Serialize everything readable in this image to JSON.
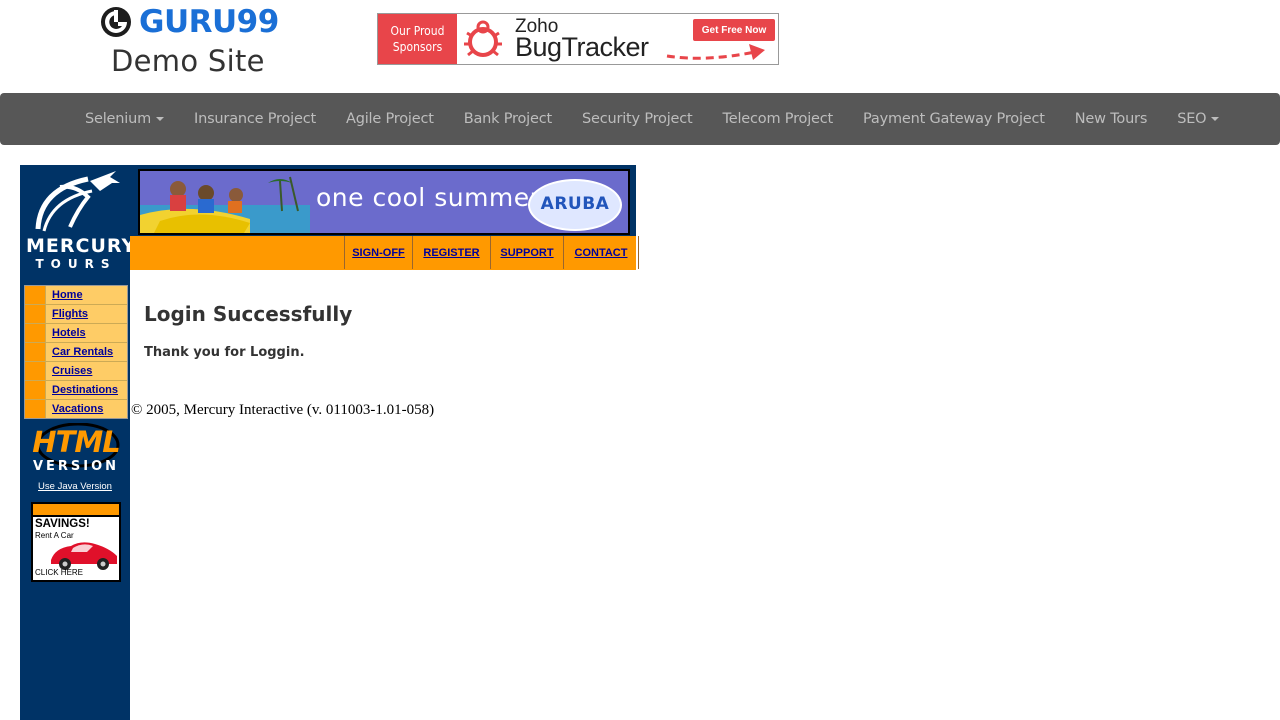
{
  "header": {
    "brand": "GURU99",
    "subtitle": "Demo Site",
    "sponsor": {
      "left_line1": "Our Proud",
      "left_line2": "Sponsors",
      "zoho": "Zoho",
      "product": "BugTracker",
      "cta": "Get Free Now"
    }
  },
  "navbar": {
    "items": [
      {
        "label": "Selenium",
        "dropdown": true
      },
      {
        "label": "Insurance Project"
      },
      {
        "label": "Agile Project"
      },
      {
        "label": "Bank Project"
      },
      {
        "label": "Security Project"
      },
      {
        "label": "Telecom Project"
      },
      {
        "label": "Payment Gateway Project"
      },
      {
        "label": "New Tours"
      },
      {
        "label": "SEO",
        "dropdown": true
      }
    ]
  },
  "mercury": {
    "logo_word1": "MERCURY",
    "logo_word2": "TOURS",
    "banner_text": "one cool summer",
    "banner_badge": "ARUBA",
    "top_links": [
      "SIGN-OFF",
      "REGISTER",
      "SUPPORT",
      "CONTACT"
    ],
    "menu": [
      "Home",
      "Flights",
      "Hotels",
      "Car Rentals",
      "Cruises",
      "Destinations",
      "Vacations"
    ],
    "html_version_line1": "HTML",
    "html_version_line2": "VERSION",
    "java_link": "Use Java Version",
    "savings_title": "SAVINGS!",
    "savings_sub": "Rent A Car",
    "savings_click": "CLICK HERE"
  },
  "content": {
    "title": "Login Successfully",
    "message": "Thank you for Loggin.",
    "copyright": "© 2005, Mercury Interactive (v. 011003-1.01-058)"
  },
  "colors": {
    "navbar_bg": "#575757",
    "mercury_blue": "#003366",
    "mercury_orange": "#ff9900",
    "link_blue": "#000099",
    "brand_blue": "#1a6fd6",
    "sponsor_red": "#e8454a"
  }
}
